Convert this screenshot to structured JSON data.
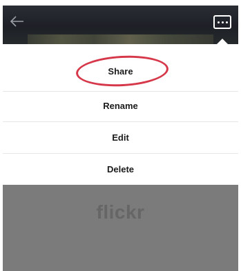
{
  "header": {
    "back_icon": "arrow-left-icon",
    "more_icon": "more-options-icon"
  },
  "menu": {
    "items": [
      {
        "label": "Share"
      },
      {
        "label": "Rename"
      },
      {
        "label": "Edit"
      },
      {
        "label": "Delete"
      }
    ],
    "highlighted_item": "Share",
    "highlight_color": "#d6384a"
  },
  "watermark": {
    "text": "flickr"
  },
  "colors": {
    "header_bg": "#1d2026",
    "menu_bg": "#ffffff",
    "overlay_bg": "#7b7b7b"
  }
}
